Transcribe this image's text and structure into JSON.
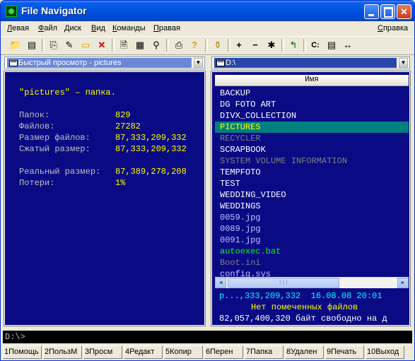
{
  "window": {
    "title": "File Navigator"
  },
  "menu": {
    "items": [
      {
        "label": "Левая",
        "underline": "Л",
        "rest": "евая"
      },
      {
        "label": "Файл",
        "underline": "Ф",
        "rest": "айл"
      },
      {
        "label": "Диск",
        "underline": "Д",
        "rest": "иск"
      },
      {
        "label": "Вид",
        "underline": "В",
        "rest": "ид"
      },
      {
        "label": "Команды",
        "underline": "К",
        "rest": "оманды"
      },
      {
        "label": "Правая",
        "underline": "П",
        "rest": "равая"
      }
    ],
    "help": {
      "label": "Справка",
      "underline": "С",
      "rest": "правка"
    }
  },
  "toolbar": {
    "icons": [
      "new-folder-icon",
      "select-icon",
      "copy-to-icon",
      "rename-icon",
      "folder-icon",
      "delete-icon",
      "view-file-icon",
      "compress-icon",
      "find-icon",
      "print-icon",
      "help-icon",
      "filter-icon",
      "select-plus-icon",
      "select-minus-icon",
      "invert-selection-icon",
      "parent-dir-icon",
      "drive-icon",
      "panel-icon",
      "swap-panels-icon"
    ],
    "drive_label": "C:",
    "plus": "+",
    "minus": "−",
    "star": "✱"
  },
  "left_panel": {
    "header": "Быстрый просмотр - pictures",
    "info_line": "\"pictures\" – папка.",
    "stats": [
      {
        "label": "Папок:",
        "value": "829"
      },
      {
        "label": "Файлов:",
        "value": "27282"
      },
      {
        "label": "Размер файлов:",
        "value": "87,333,209,332"
      },
      {
        "label": "Сжатый размер:",
        "value": "87,333,209,332"
      }
    ],
    "stats2": [
      {
        "label": "Реальный размер:",
        "value": "87,389,278,208"
      },
      {
        "label": "Потери:",
        "value": "1%"
      }
    ]
  },
  "right_panel": {
    "drive": "D:\\",
    "column_header": "Имя",
    "files": [
      {
        "name": "BACKUP",
        "kind": "dir"
      },
      {
        "name": "DG FOTO ART",
        "kind": "dir"
      },
      {
        "name": "DIVX_COLLECTION",
        "kind": "dir"
      },
      {
        "name": "PICTURES",
        "kind": "selected"
      },
      {
        "name": "RECYCLER",
        "kind": "dim"
      },
      {
        "name": "SCRAPBOOK",
        "kind": "dir"
      },
      {
        "name": "SYSTEM VOLUME INFORMATION",
        "kind": "dim"
      },
      {
        "name": "TEMPFOTO",
        "kind": "dir"
      },
      {
        "name": "TEST",
        "kind": "dir"
      },
      {
        "name": "WEDDING_VIDEO",
        "kind": "dir"
      },
      {
        "name": "WEDDINGS",
        "kind": "dir"
      },
      {
        "name": "0059.jpg",
        "kind": "file"
      },
      {
        "name": "0089.jpg",
        "kind": "file"
      },
      {
        "name": "0091.jpg",
        "kind": "file"
      },
      {
        "name": "autoexec.bat",
        "kind": "exe"
      },
      {
        "name": "Boot.ini",
        "kind": "dim"
      },
      {
        "name": "config.sys",
        "kind": "file"
      }
    ],
    "status_info": "p...,333,209,332  16.08.08 20:01",
    "status_marked": "Нет помеченных файлов",
    "status_free": "82,057,400,320 байт свободно на д"
  },
  "command_line": {
    "prompt": "D:\\>"
  },
  "fkeys": [
    {
      "key": "1",
      "label": "Помощь"
    },
    {
      "key": "2",
      "label": "ПользМ"
    },
    {
      "key": "3",
      "label": "Просм"
    },
    {
      "key": "4",
      "label": "Редакт"
    },
    {
      "key": "5",
      "label": "Копир"
    },
    {
      "key": "6",
      "label": "Перен"
    },
    {
      "key": "7",
      "label": "Папка"
    },
    {
      "key": "8",
      "label": "Удален"
    },
    {
      "key": "9",
      "label": "Печать"
    },
    {
      "key": "10",
      "label": "Выход"
    }
  ]
}
